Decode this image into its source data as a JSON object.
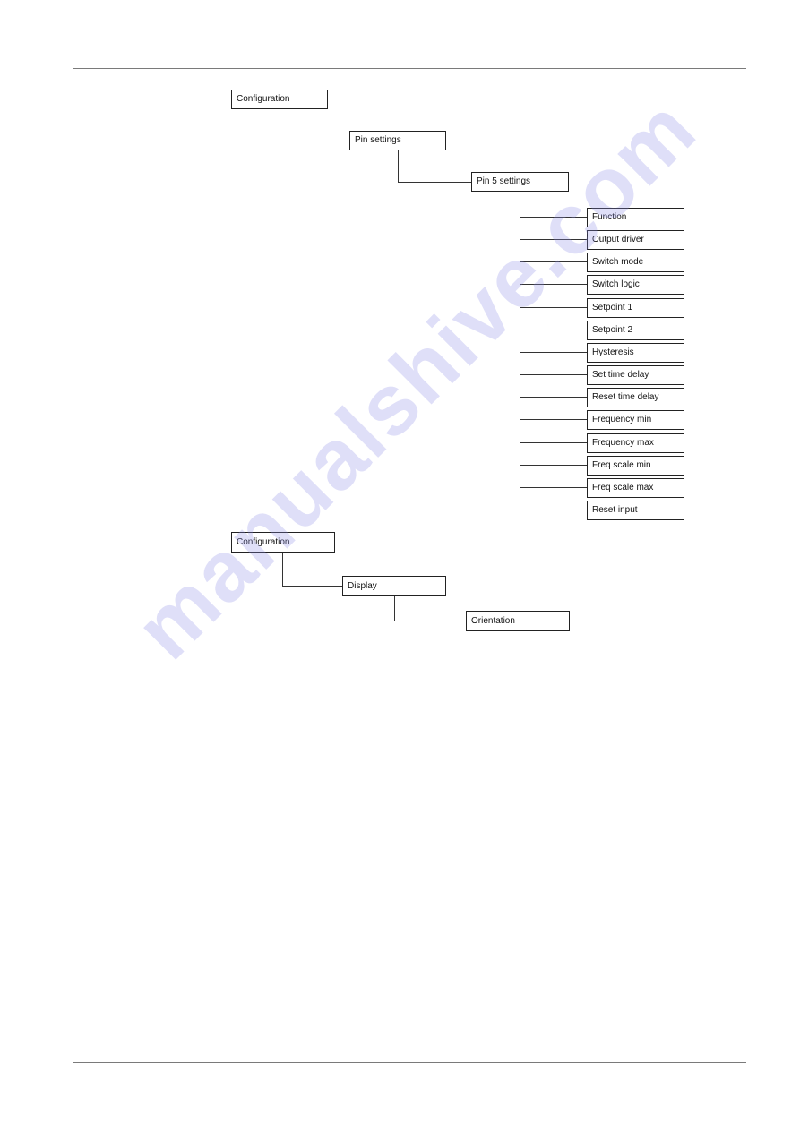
{
  "diagram1": {
    "root": "Configuration",
    "level2": "Pin settings",
    "level3": "Pin 5 settings",
    "children": [
      "Function",
      "Output driver",
      "Switch mode",
      "Switch logic",
      "Setpoint 1",
      "Setpoint 2",
      "Hysteresis",
      "Set time delay",
      "Reset time delay",
      "Frequency min",
      "Frequency max",
      "Freq scale min",
      "Freq scale max",
      "Reset input"
    ]
  },
  "diagram2": {
    "root": "Configuration",
    "level2": "Display",
    "level3": "Orientation"
  },
  "watermark": "manualshive.com"
}
